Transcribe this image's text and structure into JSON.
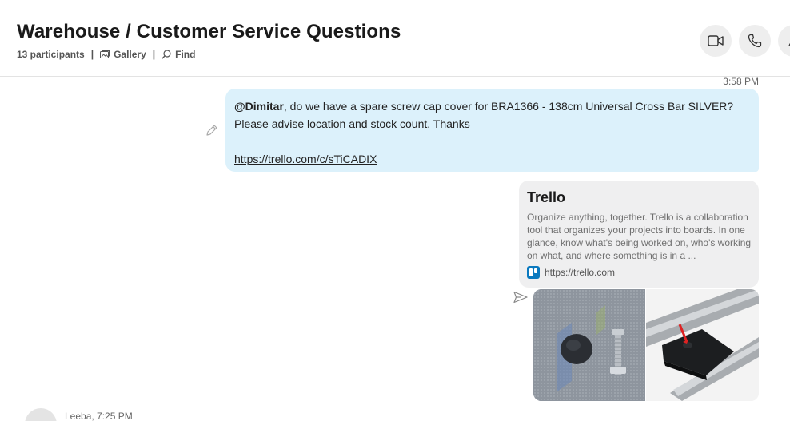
{
  "header": {
    "title": "Warehouse / Customer Service Questions",
    "participants": "13 participants",
    "separator": "|",
    "gallery_label": "Gallery",
    "find_label": "Find",
    "video_icon": "video-camera-icon",
    "call_icon": "phone-icon",
    "more_icon": "add-people-icon"
  },
  "messages": [
    {
      "timestamp": "3:58 PM",
      "mention": "@Dimitar",
      "text": ", do we have a spare screw cap cover for BRA1366 - 138cm Universal Cross Bar SILVER? Please advise location and stock count. Thanks",
      "link": "https://trello.com/c/sTiCADIX",
      "preview": {
        "title": "Trello",
        "description": "Organize anything, together. Trello is a collaboration tool that organizes your projects into boards. In one glance, know what's being worked on, who's working on what, and where something is in a ...",
        "source": "https://trello.com"
      }
    }
  ],
  "next_message": {
    "sender": "Leeba, 7:25 PM"
  },
  "colors": {
    "bubble_bg": "#dcf1fb",
    "card_bg": "#efeff0",
    "trello_blue": "#0a79bf"
  }
}
